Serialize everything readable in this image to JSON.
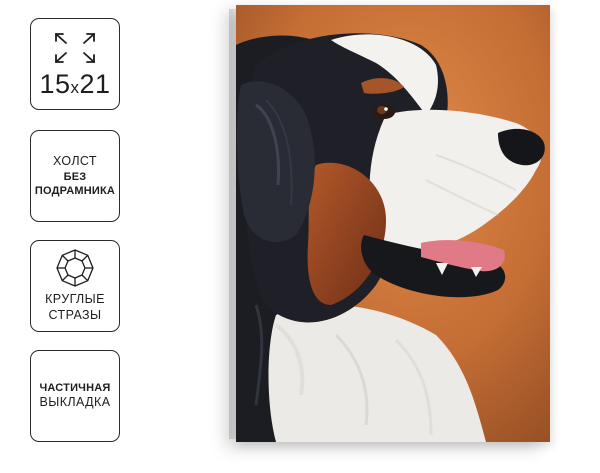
{
  "badges": {
    "size": {
      "number1": "15",
      "separator": "x",
      "number2": "21"
    },
    "canvas": {
      "line1": "ХОЛСТ",
      "line2": "БЕЗ",
      "line3": "ПОДРАМНИКА"
    },
    "stones": {
      "line1": "КРУГЛЫЕ",
      "line2": "СТРАЗЫ"
    },
    "layout": {
      "line1": "ЧАСТИЧНАЯ",
      "line2": "ВЫКЛАДКА"
    }
  },
  "icons": [
    "expand-arrows-icon",
    "round-gem-icon"
  ],
  "colors": {
    "border": "#2b2b2b",
    "background_orange": "#c7733a",
    "dog_black": "#1c1d22",
    "dog_white": "#f2f1ee",
    "dog_tan": "#9a4a22",
    "tongue": "#e07a86"
  }
}
